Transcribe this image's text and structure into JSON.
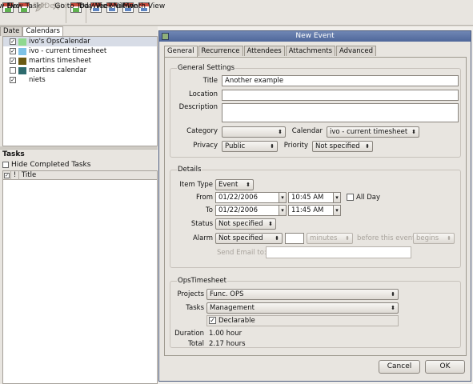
{
  "toolbar": {
    "buttons": [
      {
        "label": "New Event",
        "icon": "new-event-icon"
      },
      {
        "label": "New Task",
        "icon": "new-task-icon"
      },
      {
        "label": "Edit",
        "icon": "edit-icon",
        "disabled": true
      },
      {
        "label": "Delete",
        "icon": "delete-icon",
        "disabled": true
      },
      {
        "label": "Go to Today",
        "icon": "go-to-today-icon"
      },
      {
        "label": "Day View",
        "icon": "day-view-icon"
      },
      {
        "label": "Week View",
        "icon": "week-view-icon"
      },
      {
        "label": "Multiweek",
        "icon": "multiweek-icon"
      },
      {
        "label": "Month View",
        "icon": "month-view-icon"
      }
    ]
  },
  "left_panel": {
    "tabs": [
      "Date",
      "Calendars"
    ],
    "calendars": [
      {
        "name": "ivo's OpsCalendar",
        "checked": true,
        "color": "#8fd88f"
      },
      {
        "name": "ivo - current timesheet",
        "checked": true,
        "color": "#7ec2e6"
      },
      {
        "name": "martins timesheet",
        "checked": true,
        "color": "#6b5a12"
      },
      {
        "name": "martins calendar",
        "checked": false,
        "color": "#2e6b6e"
      },
      {
        "name": "niets",
        "checked": true,
        "color": "#ffffff"
      }
    ],
    "tasks": {
      "title": "Tasks",
      "hide_completed": "Hide Completed Tasks",
      "columns": {
        "priority": "!",
        "title": "Title"
      }
    }
  },
  "dialog": {
    "title": "New Event",
    "tabs": [
      "General",
      "Recurrence",
      "Attendees",
      "Attachments",
      "Advanced"
    ],
    "general_settings": {
      "group_title": "General Settings",
      "title_label": "Title",
      "title_value": "Another example",
      "location_label": "Location",
      "location_value": "",
      "description_label": "Description",
      "description_value": "",
      "category_label": "Category",
      "category_value": "",
      "calendar_label": "Calendar",
      "calendar_value": "ivo - current timesheet",
      "privacy_label": "Privacy",
      "privacy_value": "Public",
      "priority_label": "Priority",
      "priority_value": "Not specified"
    },
    "details": {
      "group_title": "Details",
      "item_type_label": "Item Type",
      "item_type_value": "Event",
      "from_label": "From",
      "from_date": "01/22/2006",
      "from_time": "10:45 AM",
      "all_day_label": "All Day",
      "to_label": "To",
      "to_date": "01/22/2006",
      "to_time": "11:45 AM",
      "status_label": "Status",
      "status_value": "Not specified",
      "alarm_label": "Alarm",
      "alarm_value": "Not specified",
      "alarm_amount": "",
      "alarm_unit": "minutes",
      "alarm_before": "before this event",
      "alarm_relation": "begins",
      "send_email_label": "Send Email to:",
      "send_email_value": ""
    },
    "ops_timesheet": {
      "group_title": "OpsTimesheet",
      "projects_label": "Projects",
      "projects_value": "Func. OPS",
      "tasks_label": "Tasks",
      "tasks_value": "Management",
      "declarable_label": "Declarable",
      "declarable_checked": true,
      "duration_label": "Duration",
      "duration_value": "1.00 hour",
      "total_label": "Total",
      "total_value": "2.17 hours"
    },
    "cancel_label": "Cancel",
    "ok_label": "OK"
  }
}
